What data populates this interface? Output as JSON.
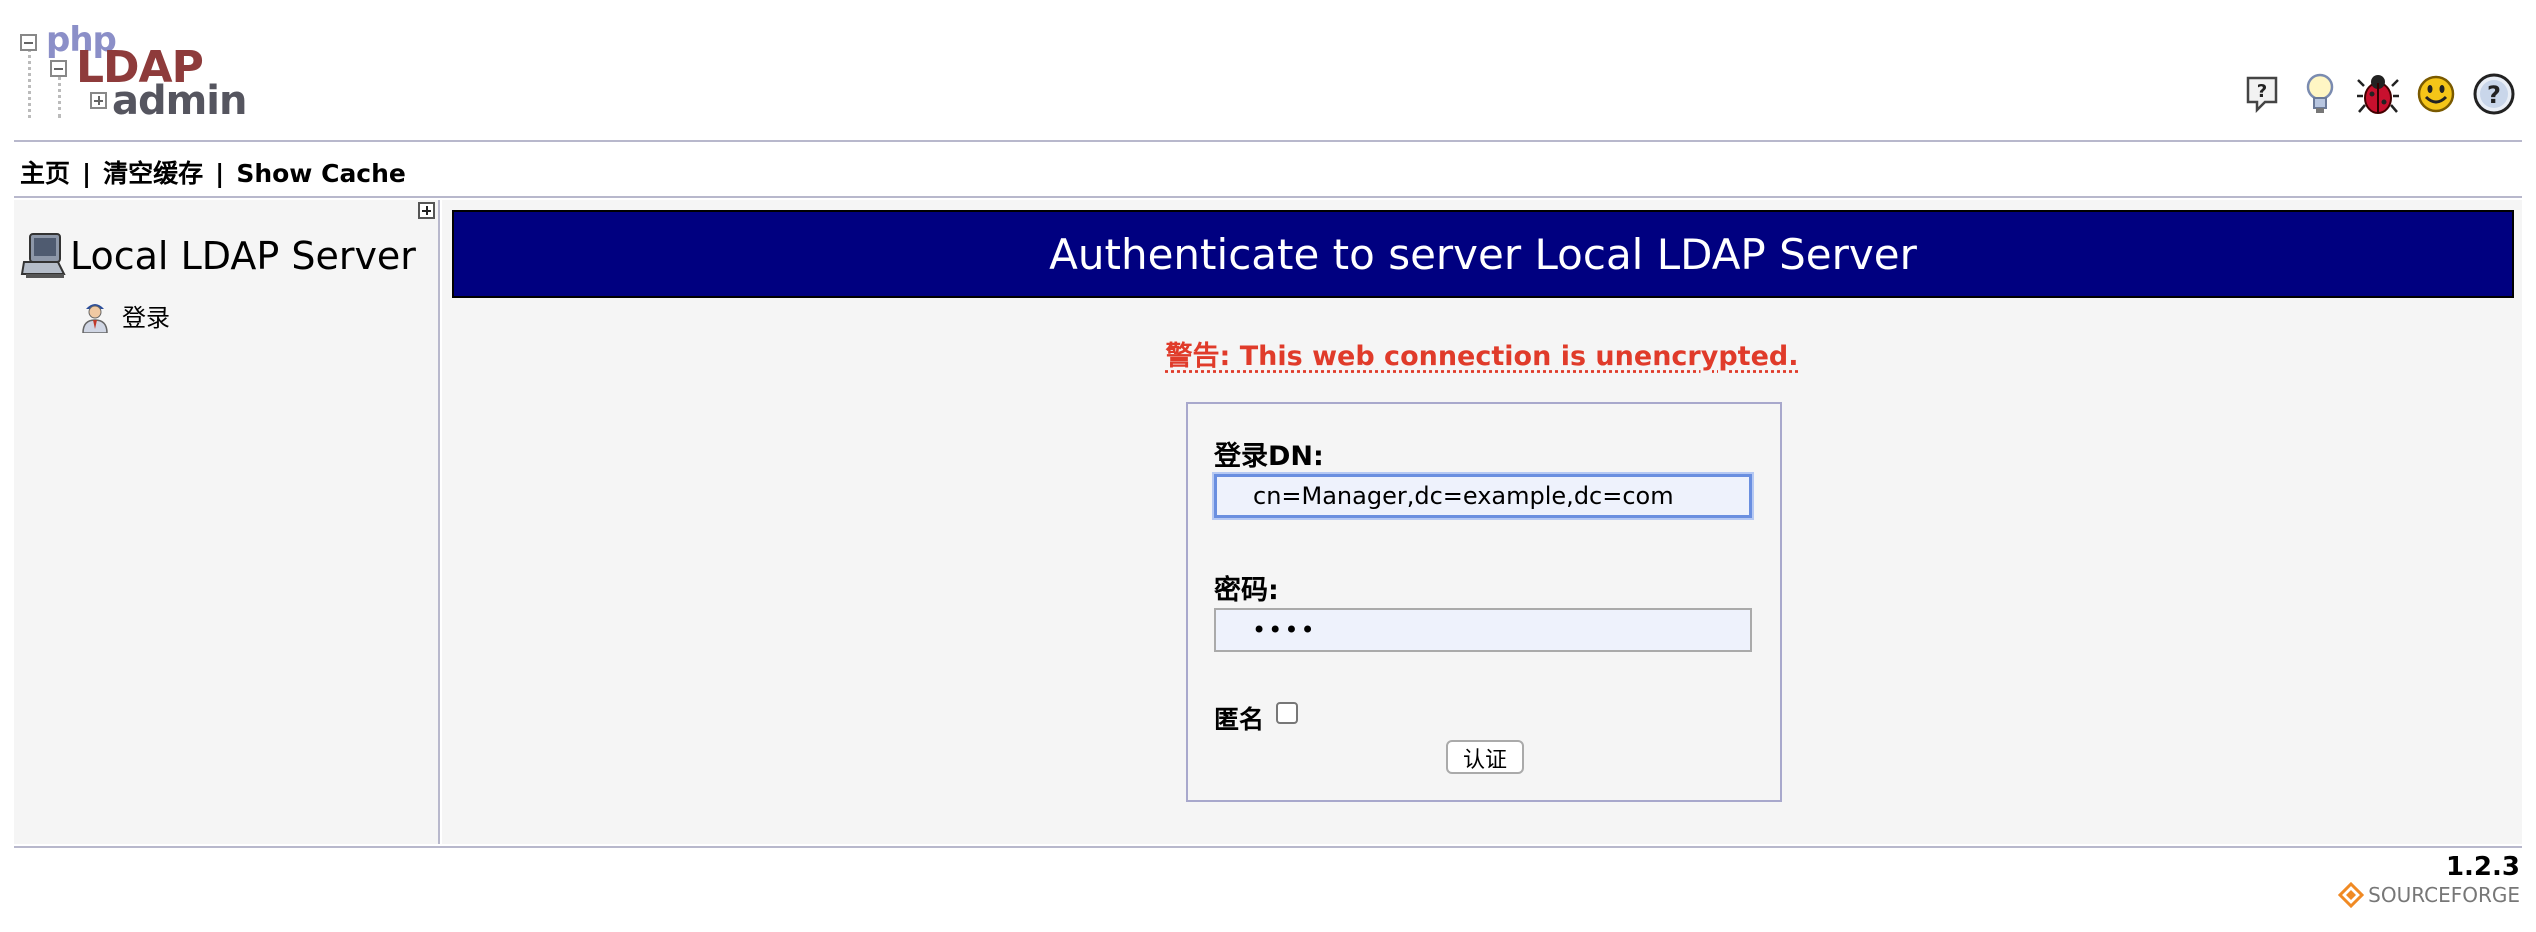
{
  "logo": {
    "php": "php",
    "ldap": "LDAP",
    "admin": "admin"
  },
  "header_icons": [
    "help-icon",
    "lightbulb-icon",
    "bug-icon",
    "smiley-icon",
    "question-icon"
  ],
  "menu": {
    "home": "主页",
    "clear_cache": "清空缓存",
    "show_cache": "Show Cache",
    "separator": "|"
  },
  "tree": {
    "server_name": "Local LDAP Server",
    "login_label": "登录"
  },
  "auth": {
    "title": "Authenticate to server Local LDAP Server",
    "warning": "警告: This web connection is unencrypted.",
    "dn_label": "登录DN:",
    "dn_value": "cn=Manager,dc=example,dc=com",
    "password_label": "密码:",
    "password_value": "••••",
    "anonymous_label": "匿名",
    "submit_label": "认证"
  },
  "footer": {
    "version": "1.2.3",
    "sourceforge": "SOURCEFORGE"
  },
  "colors": {
    "title_bg": "#000080",
    "warning": "#e03b2a",
    "panel_bg": "#f5f5f5",
    "border": "#b8b8cc"
  }
}
